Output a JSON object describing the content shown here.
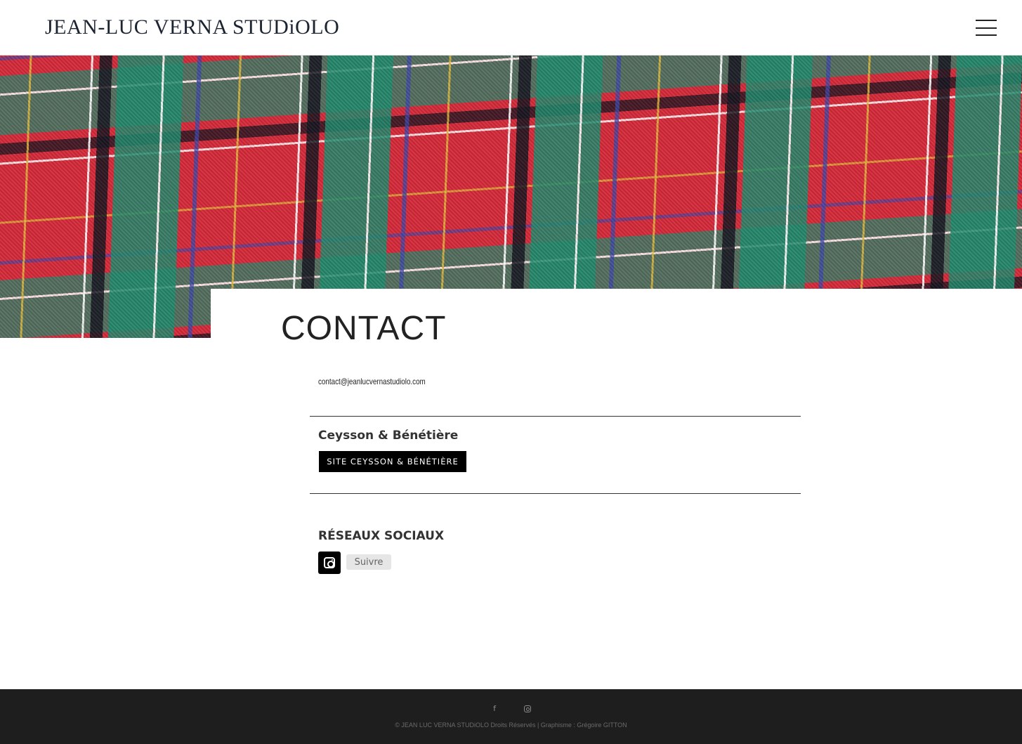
{
  "header": {
    "logo_text": "JEAN-LUC VERNA STUDiOLO",
    "menu_icon": "hamburger-menu-icon"
  },
  "hero": {
    "image": "red-green-tartan-fabric"
  },
  "main": {
    "title": "CONTACT",
    "email": "contact@jeanlucvernastudiolo.com",
    "gallery": {
      "name": "Ceysson & Bénétière",
      "button_label": "SITE CEYSSON & BÉNÉTIÈRE"
    },
    "social": {
      "title": "RÉSEAUX SOCIAUX",
      "instagram_icon": "instagram-icon",
      "follow_label": "Suivre"
    }
  },
  "footer": {
    "facebook_glyph": "f",
    "icons": [
      "facebook-icon",
      "instagram-icon"
    ],
    "copyright": "© JEAN LUC VERNA STUDiOLO Droits Réservés | Graphisme : Grégoire GITTON"
  },
  "colors": {
    "footer_bg": "#1e1e1e",
    "button_bg": "#000000",
    "text": "#222222"
  }
}
